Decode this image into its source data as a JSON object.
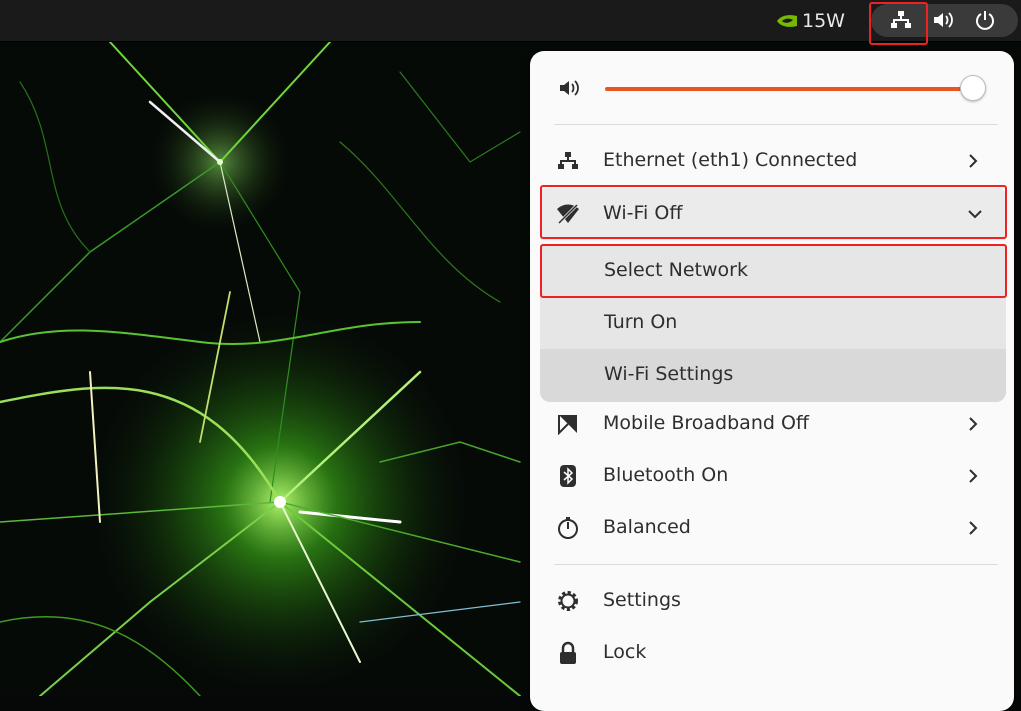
{
  "topbar": {
    "gpu_power": "15W",
    "icons": [
      "nvidia-icon",
      "network-wired-icon",
      "volume-icon",
      "power-icon"
    ]
  },
  "menu": {
    "volume_level_percent": 100,
    "items": [
      {
        "name": "ethernet",
        "label": "Ethernet (eth1) Connected",
        "icon": "network-wired-icon"
      },
      {
        "name": "wifi",
        "label": "Wi-Fi Off",
        "icon": "wifi-off-icon"
      },
      {
        "name": "mobile-broadband",
        "label": "Mobile Broadband Off",
        "icon": "mobile-broadband-off-icon"
      },
      {
        "name": "bluetooth",
        "label": "Bluetooth On",
        "icon": "bluetooth-icon"
      },
      {
        "name": "power-mode",
        "label": "Balanced",
        "icon": "power-profile-icon"
      },
      {
        "name": "settings",
        "label": "Settings",
        "icon": "gear-icon"
      },
      {
        "name": "lock",
        "label": "Lock",
        "icon": "lock-icon"
      }
    ],
    "wifi_submenu": [
      {
        "label": "Select Network"
      },
      {
        "label": "Turn On"
      },
      {
        "label": "Wi-Fi Settings"
      }
    ]
  },
  "colors": {
    "accent": "#e95420",
    "highlight": "#e22222",
    "nvidia": "#76b900"
  }
}
